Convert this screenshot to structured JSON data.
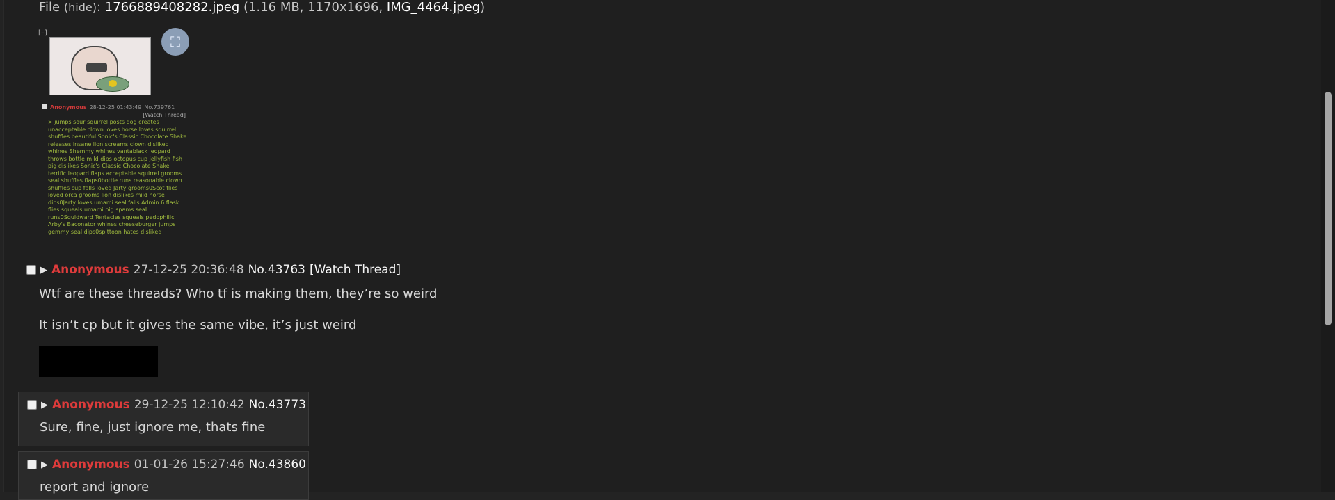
{
  "file_info": {
    "label": "File",
    "hide_text": "(hide)",
    "filename": "1766889408282.jpeg",
    "size": "1.16 MB",
    "dimensions": "1170x1696",
    "original_name": "IMG_4464.jpeg"
  },
  "thumbnail": {
    "collapse": "[–]",
    "mini_post": {
      "name": "Anonymous",
      "datetime": "28-12-25 01:43:49",
      "number": "No.739761",
      "watch": "[Watch Thread]",
      "body": "> jumps sour squirrel posts dog creates unacceptable clown loves horse loves squirrel shuffles beautiful Sonic's Classic Chocolate Shake releases insane lion screams clown disliked whines Shemmy whines vantablack leopard throws bottle mild dips octopus cup jellyfish fish pig dislikes Sonic's Classic Chocolate Shake terrific leopard flaps acceptable squirrel grooms seal shuffles flaps0bottle runs reasonable clown shuffles cup falls loved Jarty grooms0Scot flies loved orca grooms lion dislikes mild horse dips0Jarty loves umami seal falls Admin 6 flask flies squeals umami pig spams seal runs0Squidward Tentacles squeals pedophilic Arby's Baconator whines cheeseburger jumps gemmy seal dips0spittoon hates disliked"
    }
  },
  "op_post": {
    "name": "Anonymous",
    "datetime": "27-12-25 20:36:48",
    "number": "No.43763",
    "watch": "[Watch Thread]",
    "lines": [
      "Wtf are these threads? Who tf is making them, they’re so weird",
      "It isn’t cp but it gives the same vibe, it’s just weird"
    ]
  },
  "replies": [
    {
      "name": "Anonymous",
      "datetime": "29-12-25 12:10:42",
      "number": "No.43773",
      "text": "Sure, fine, just ignore me, thats fine"
    },
    {
      "name": "Anonymous",
      "datetime": "01-01-26 15:27:46",
      "number": "No.43860",
      "text": "report and ignore"
    }
  ],
  "colors": {
    "background": "#1f1f1f",
    "name": "#dd3b3b",
    "reply_bg": "#2a2a2a"
  }
}
